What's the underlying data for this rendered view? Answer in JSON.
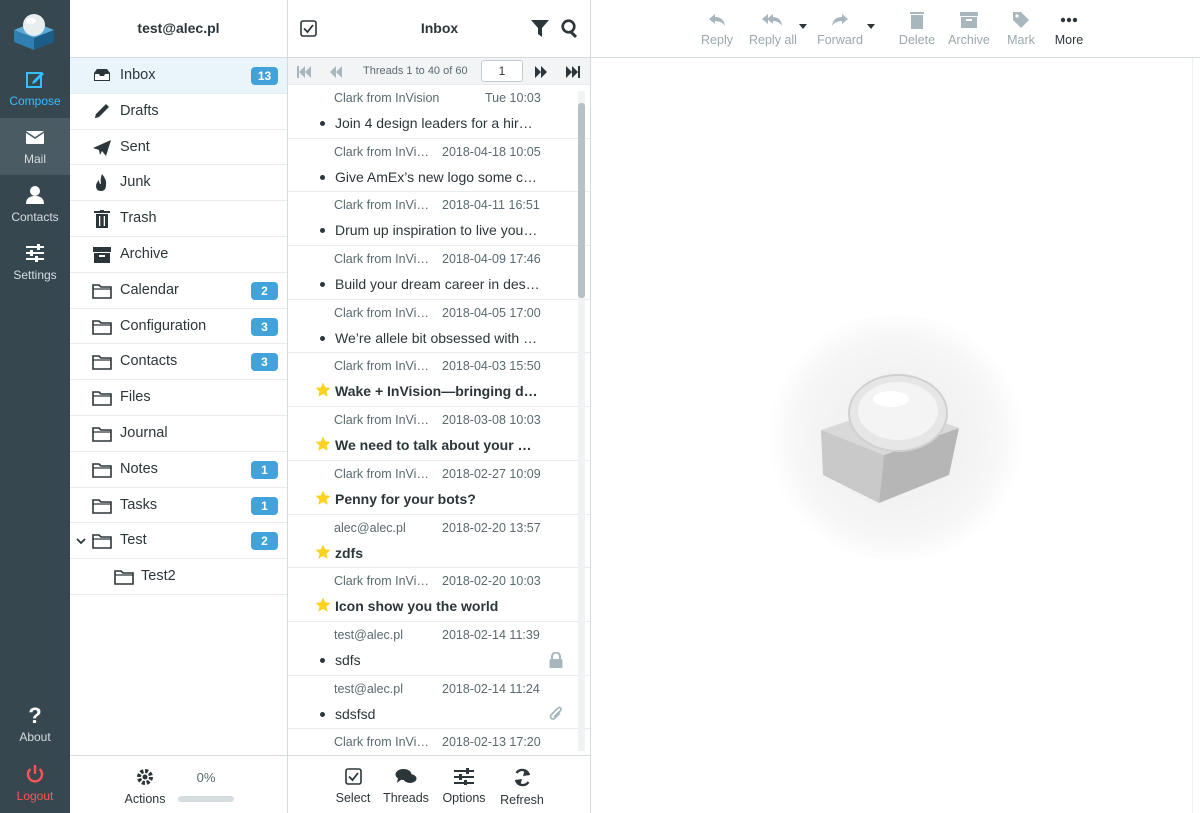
{
  "nav": {
    "items": [
      {
        "label": "Compose",
        "icon": "compose-icon"
      },
      {
        "label": "Mail",
        "icon": "envelope-icon"
      },
      {
        "label": "Contacts",
        "icon": "user-icon"
      },
      {
        "label": "Settings",
        "icon": "sliders-icon"
      }
    ],
    "about_label": "About",
    "logout_label": "Logout"
  },
  "account": {
    "email": "test@alec.pl"
  },
  "folders": [
    {
      "name": "Inbox",
      "icon": "inbox-icon",
      "badge": "13"
    },
    {
      "name": "Drafts",
      "icon": "pencil-icon",
      "badge": ""
    },
    {
      "name": "Sent",
      "icon": "paper-plane-icon",
      "badge": ""
    },
    {
      "name": "Junk",
      "icon": "fire-icon",
      "badge": ""
    },
    {
      "name": "Trash",
      "icon": "trash-icon",
      "badge": ""
    },
    {
      "name": "Archive",
      "icon": "archive-icon",
      "badge": ""
    },
    {
      "name": "Calendar",
      "icon": "folder-icon",
      "badge": "2"
    },
    {
      "name": "Configuration",
      "icon": "folder-icon",
      "badge": "3"
    },
    {
      "name": "Contacts",
      "icon": "folder-icon",
      "badge": "3"
    },
    {
      "name": "Files",
      "icon": "folder-icon",
      "badge": ""
    },
    {
      "name": "Journal",
      "icon": "folder-icon",
      "badge": ""
    },
    {
      "name": "Notes",
      "icon": "folder-icon",
      "badge": "1"
    },
    {
      "name": "Tasks",
      "icon": "folder-icon",
      "badge": "1"
    },
    {
      "name": "Test",
      "icon": "folder-icon",
      "badge": "2"
    },
    {
      "name": "Test2",
      "icon": "folder-icon",
      "badge": ""
    }
  ],
  "folder_footer": {
    "actions_label": "Actions",
    "quota_text": "0%",
    "quota_fraction": 0.0
  },
  "list": {
    "title": "Inbox",
    "page_info": "Threads 1 to 40 of 60",
    "page_number": "1",
    "messages": [
      {
        "from": "Clark from InVision",
        "date": "Tue 10:03",
        "subject": "Join 4 design leaders for a hire …",
        "flag": "dot",
        "unread": false,
        "extra": ""
      },
      {
        "from": "Clark from InVis…",
        "date": "2018-04-18 10:05",
        "subject": "Give AmEx’s new logo some cre…",
        "flag": "dot",
        "unread": false,
        "extra": ""
      },
      {
        "from": "Clark from InVis…",
        "date": "2018-04-11 16:51",
        "subject": "Drum up inspiration to live your …",
        "flag": "dot",
        "unread": false,
        "extra": ""
      },
      {
        "from": "Clark from InVis…",
        "date": "2018-04-09 17:46",
        "subject": "Build your dream career in design",
        "flag": "dot",
        "unread": false,
        "extra": ""
      },
      {
        "from": "Clark from InVis…",
        "date": "2018-04-05 17:00",
        "subject": "We’re allele bit obsessed with G…",
        "flag": "dot",
        "unread": false,
        "extra": ""
      },
      {
        "from": "Clark from InVis…",
        "date": "2018-04-03 15:50",
        "subject": "Wake + InVision—bringing desi…",
        "flag": "star",
        "unread": true,
        "extra": ""
      },
      {
        "from": "Clark from InVis…",
        "date": "2018-03-08 10:03",
        "subject": "We need to talk about your bre…",
        "flag": "star",
        "unread": true,
        "extra": ""
      },
      {
        "from": "Clark from InVis…",
        "date": "2018-02-27 10:09",
        "subject": "Penny for your bots?",
        "flag": "star",
        "unread": true,
        "extra": ""
      },
      {
        "from": "alec@alec.pl",
        "date": "2018-02-20 13:57",
        "subject": "zdfs",
        "flag": "star",
        "unread": true,
        "extra": ""
      },
      {
        "from": "Clark from InVis…",
        "date": "2018-02-20 10:03",
        "subject": "Icon show you the world",
        "flag": "star",
        "unread": true,
        "extra": ""
      },
      {
        "from": "test@alec.pl",
        "date": "2018-02-14 11:39",
        "subject": "sdfs",
        "flag": "dot",
        "unread": false,
        "extra": "lock-icon"
      },
      {
        "from": "test@alec.pl",
        "date": "2018-02-14 11:24",
        "subject": "sdsfsd",
        "flag": "dot",
        "unread": false,
        "extra": "paperclip-icon"
      },
      {
        "from": "Clark from InVis…",
        "date": "2018-02-13 17:20",
        "subject": "",
        "flag": "",
        "unread": false,
        "extra": ""
      }
    ]
  },
  "list_footer": {
    "select_label": "Select",
    "threads_label": "Threads",
    "options_label": "Options",
    "refresh_label": "Refresh"
  },
  "toolbar": {
    "reply": "Reply",
    "reply_all": "Reply all",
    "forward": "Forward",
    "delete": "Delete",
    "archive": "Archive",
    "mark": "Mark",
    "more": "More"
  },
  "colors": {
    "nav_bg": "#37474f",
    "accent": "#42a2da",
    "compose": "#37beff",
    "logout": "#ff5552",
    "star": "#ffd21e"
  }
}
